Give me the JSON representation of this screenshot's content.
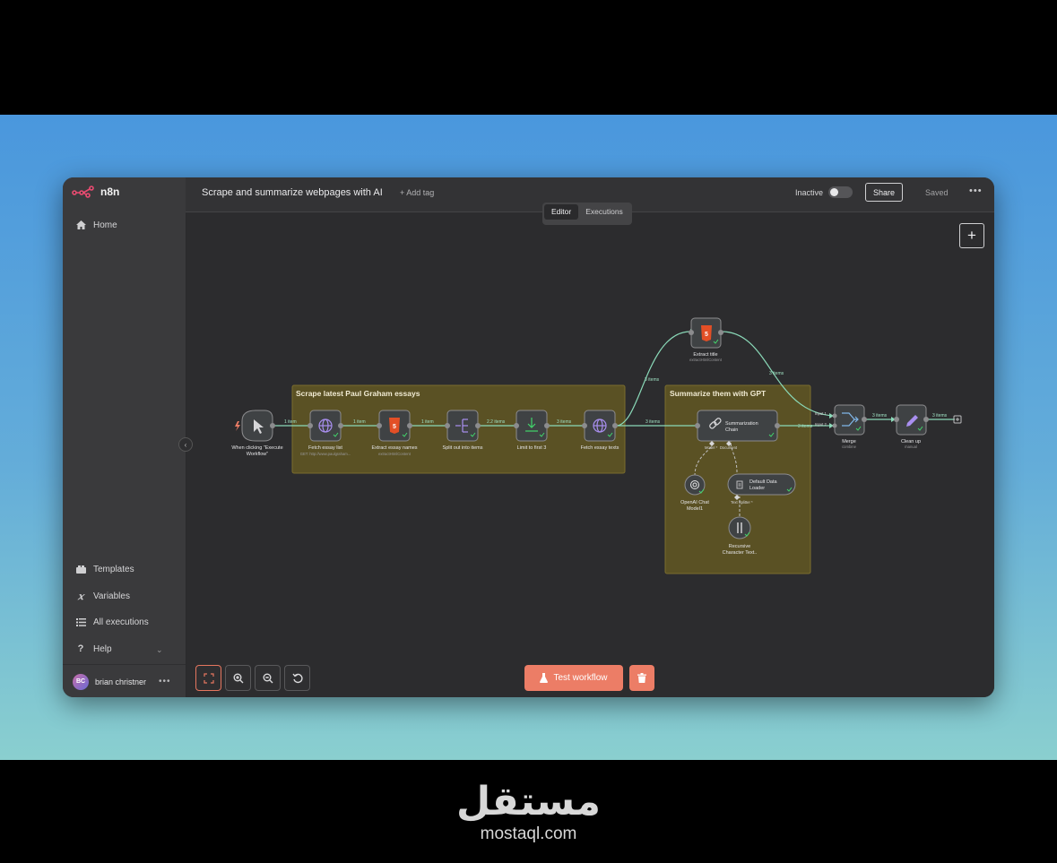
{
  "app": {
    "brand": "n8n",
    "workflow_title": "Scrape and summarize webpages with AI",
    "add_tag": "+ Add tag",
    "status": "Inactive",
    "share": "Share",
    "saved": "Saved",
    "tabs": [
      {
        "label": "Editor",
        "active": true
      },
      {
        "label": "Executions",
        "active": false
      }
    ]
  },
  "sidebar": {
    "items": [
      {
        "label": "Home",
        "icon": "home-icon"
      },
      {
        "label": "Templates",
        "icon": "templates-icon"
      },
      {
        "label": "Variables",
        "icon": "variables-icon"
      },
      {
        "label": "All executions",
        "icon": "list-icon"
      },
      {
        "label": "Help",
        "icon": "help-icon"
      }
    ],
    "user": {
      "initials": "BC",
      "name": "brian christner"
    }
  },
  "groups": [
    {
      "title": "Scrape latest Paul Graham essays"
    },
    {
      "title": "Summarize them with GPT"
    }
  ],
  "nodes": [
    {
      "id": "trigger",
      "label": "When clicking \"Execute",
      "label2": "Workflow\"",
      "sub": "",
      "icon": "cursor-icon"
    },
    {
      "id": "fetch-list",
      "label": "Fetch essay list",
      "sub": "GET: http://www.paulgraham...",
      "icon": "globe-icon"
    },
    {
      "id": "extract-names",
      "label": "Extract essay names",
      "sub": "extractHtmlContent",
      "icon": "html-icon"
    },
    {
      "id": "split-out",
      "label": "Split out into items",
      "sub": "",
      "icon": "split-icon"
    },
    {
      "id": "limit",
      "label": "Limit to first 3",
      "sub": "",
      "icon": "limit-icon"
    },
    {
      "id": "fetch-texts",
      "label": "Fetch essay texts",
      "sub": "",
      "icon": "globe-icon"
    },
    {
      "id": "extract-title",
      "label": "Extract title",
      "sub": "extractHtmlContent",
      "icon": "html-icon"
    },
    {
      "id": "summarization",
      "label": "Summarization",
      "label2": "Chain",
      "sub": "",
      "icon": "link-icon"
    },
    {
      "id": "openai",
      "label": "OpenAI Chat",
      "label2": "Model1",
      "sub": "",
      "icon": "openai-icon"
    },
    {
      "id": "data-loader",
      "label": "Default Data",
      "label2": "Loader",
      "sub": "",
      "icon": "document-icon"
    },
    {
      "id": "splitter",
      "label": "Recursive",
      "label2": "Character Text..",
      "sub": "",
      "icon": "splitter-icon"
    },
    {
      "id": "merge",
      "label": "Merge",
      "sub": "combine",
      "icon": "merge-icon"
    },
    {
      "id": "cleanup",
      "label": "Clean up",
      "sub": "manual",
      "icon": "pencil-icon"
    }
  ],
  "edge_labels": {
    "e1": "1 item",
    "e2": "1 item",
    "e3": "1 item",
    "e4": "2.2 items",
    "e5": "3 items",
    "e6": "3 items",
    "e7": "3 items",
    "e8": "3 items",
    "e9": "3 items",
    "e10": "3 items",
    "e11": "3 items",
    "port_model": "Model *",
    "port_document": "Document",
    "port_text_splitter": "Text Splitter *",
    "port_input1": "Input 1",
    "port_input2": "Input 2"
  },
  "actions": {
    "test_workflow": "Test workflow"
  },
  "watermark": {
    "logo": "مستقل",
    "site": "mostaql.com"
  },
  "colors": {
    "accent": "#ec7d66",
    "group_fill": "#5a5124",
    "node_fill": "#3f4244",
    "success": "#42d66b",
    "edge": "#8ad9b8"
  }
}
